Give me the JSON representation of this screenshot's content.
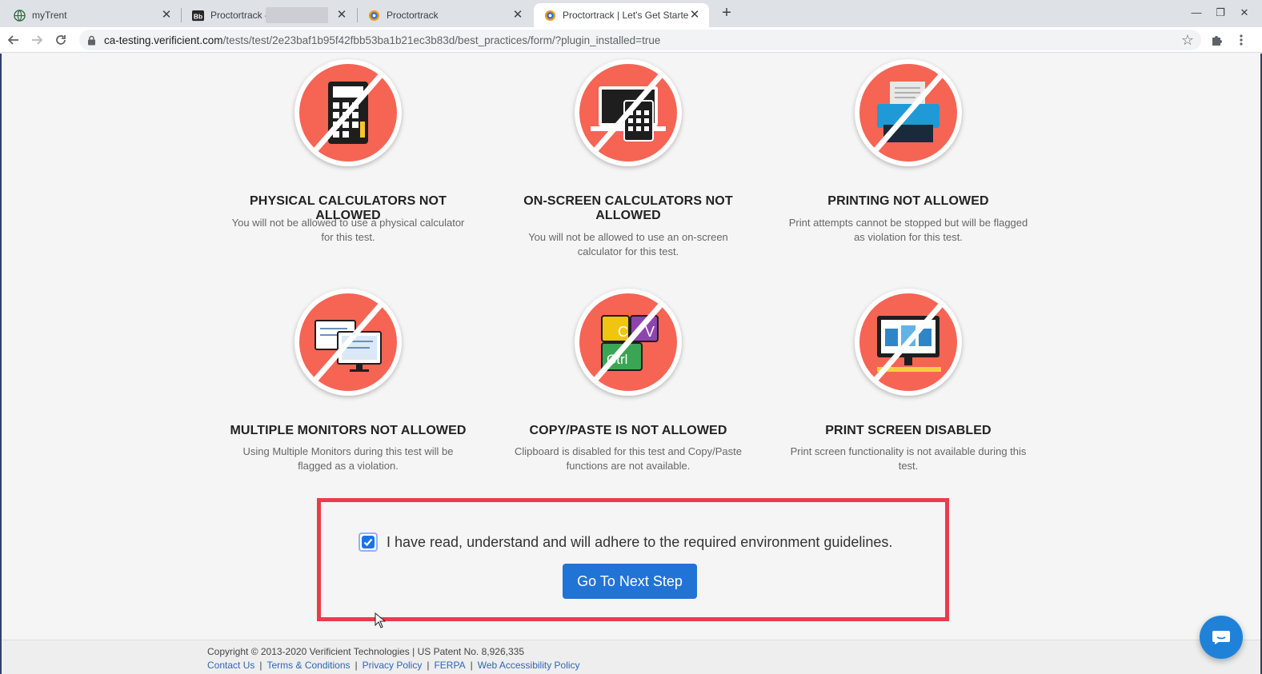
{
  "browser": {
    "tabs": [
      {
        "title": "myTrent",
        "icon": "globe-icon",
        "active": false
      },
      {
        "title": "Proctortrack –",
        "icon": "blackboard-icon",
        "active": false
      },
      {
        "title": "Proctortrack",
        "icon": "proctortrack-icon",
        "active": false
      },
      {
        "title": "Proctortrack | Let's Get Started",
        "icon": "proctortrack-icon",
        "active": true
      }
    ],
    "url_domain": "ca-testing.verificient.com",
    "url_path": "/tests/test/2e23baf1b95f42fbb53ba1b21ec3b83d/best_practices/form/?plugin_installed=true"
  },
  "rules": [
    {
      "title": "PHYSICAL CALCULATORS NOT ALLOWED",
      "description": "You will not be allowed to use a physical calculator for this test.",
      "icon": "calculator-icon"
    },
    {
      "title": "ON-SCREEN CALCULATORS NOT ALLOWED",
      "description": "You will not be allowed to use an on-screen calculator for this test.",
      "icon": "onscreen-calculator-icon"
    },
    {
      "title": "PRINTING NOT ALLOWED",
      "description": "Print attempts cannot be stopped but will be flagged as violation for this test.",
      "icon": "printer-icon"
    },
    {
      "title": "MULTIPLE MONITORS NOT ALLOWED",
      "description": "Using Multiple Monitors during this test will be flagged as a violation.",
      "icon": "multiple-monitors-icon"
    },
    {
      "title": "COPY/PASTE IS NOT ALLOWED",
      "description": "Clipboard is disabled for this test and Copy/Paste functions are not available.",
      "icon": "copy-paste-keys-icon"
    },
    {
      "title": "PRINT SCREEN DISABLED",
      "description": "Print screen functionality is not available during this test.",
      "icon": "print-screen-icon"
    }
  ],
  "rule_icon_letters": {
    "c": "C",
    "v": "V",
    "ctrl": "Ctrl"
  },
  "agreement": {
    "checked": true,
    "label": "I have read, understand and will adhere to the required environment guidelines.",
    "button": "Go To Next Step"
  },
  "footer": {
    "copyright": "Copyright © 2013-2020 Verificient Technologies | US Patent No. 8,926,335",
    "links": [
      "Contact Us",
      "Terms & Conditions",
      "Privacy Policy",
      "FERPA",
      "Web Accessibility Policy"
    ]
  },
  "colors": {
    "prohibited_red": "#f66454",
    "button_blue": "#2273d6",
    "highlight_border": "#ec3b4a",
    "link_blue": "#2f66b3"
  }
}
